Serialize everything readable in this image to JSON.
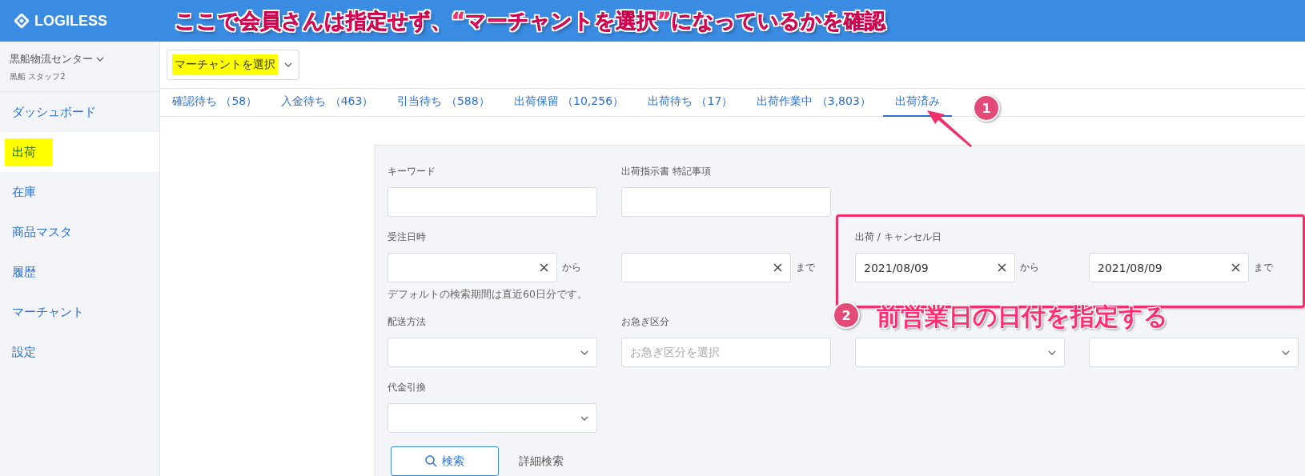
{
  "header": {
    "logo": "LOGILESS"
  },
  "annotation_title": "ここで会員さんは指定せず、“マーチャントを選択”になっているかを確認",
  "sidebar": {
    "warehouse": "黒船物流センター",
    "user": "黒船 スタッフ2",
    "items": [
      {
        "label": "ダッシュボード",
        "selected": false,
        "highlighted": false
      },
      {
        "label": "出荷",
        "selected": true,
        "highlighted": true
      },
      {
        "label": "在庫",
        "selected": false,
        "highlighted": false
      },
      {
        "label": "商品マスタ",
        "selected": false,
        "highlighted": false
      },
      {
        "label": "履歴",
        "selected": false,
        "highlighted": false
      },
      {
        "label": "マーチャント",
        "selected": false,
        "highlighted": false
      },
      {
        "label": "設定",
        "selected": false,
        "highlighted": false
      }
    ]
  },
  "merchant_select": {
    "value": "マーチャントを選択",
    "highlighted": true
  },
  "tabs": [
    {
      "label": "確認待ち （58）",
      "selected": false
    },
    {
      "label": "入金待ち （463）",
      "selected": false
    },
    {
      "label": "引当待ち （588）",
      "selected": false
    },
    {
      "label": "出荷保留 （10,256）",
      "selected": false
    },
    {
      "label": "出荷待ち （17）",
      "selected": false
    },
    {
      "label": "出荷作業中 （3,803）",
      "selected": false
    },
    {
      "label": "出荷済み",
      "selected": true
    }
  ],
  "callout_1": {
    "number": "1"
  },
  "form": {
    "rows": [
      [
        {
          "kind": "text",
          "label": "キーワード"
        },
        {
          "kind": "text",
          "label": "出荷指示書 特記事項"
        }
      ],
      [
        {
          "kind": "date",
          "label": "受注日時",
          "suffix": "から",
          "hint": "デフォルトの検索期間は直近60日分です。"
        },
        {
          "kind": "date",
          "suffix": "まで"
        },
        {
          "kind": "date_range",
          "label": "出荷 / キャンセル日",
          "framed": true,
          "from": "2021/08/09",
          "from_suffix": "から",
          "to": "2021/08/09",
          "to_suffix": "まで"
        }
      ],
      [
        {
          "kind": "select",
          "label": "配送方法"
        },
        {
          "kind": "text",
          "label": "お急ぎ区分",
          "placeholder": "お急ぎ区分を選択"
        },
        {
          "kind": "select"
        },
        {
          "kind": "select"
        }
      ],
      [
        {
          "kind": "select",
          "label": "代金引換"
        }
      ]
    ],
    "search_button": "検索",
    "advanced_link": "詳細検索"
  },
  "callout_2": {
    "number": "2",
    "text": "前営業日の日付を指定する"
  }
}
